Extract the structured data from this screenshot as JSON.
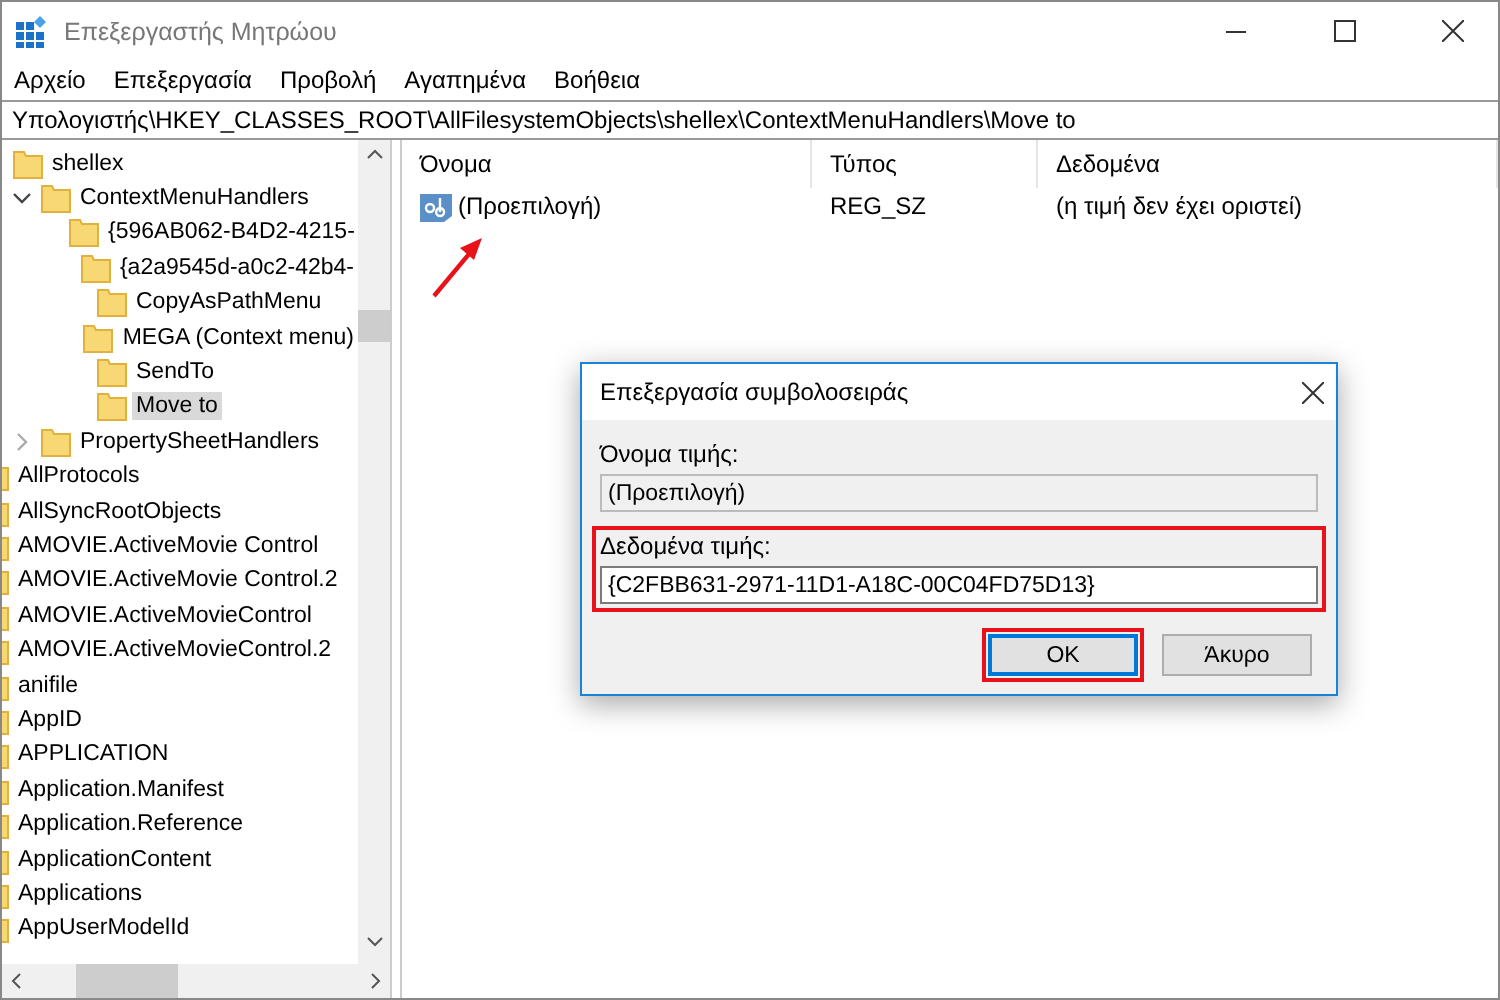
{
  "window": {
    "title": "Επεξεργαστής Μητρώου"
  },
  "menu": [
    "Αρχείο",
    "Επεξεργασία",
    "Προβολή",
    "Αγαπημένα",
    "Βοήθεια"
  ],
  "address": "Υπολογιστής\\HKEY_CLASSES_ROOT\\AllFilesystemObjects\\shellex\\ContextMenuHandlers\\Move to",
  "tree": {
    "branch": [
      {
        "label": "shellex",
        "selected": false,
        "children": [
          {
            "label": "ContextMenuHandlers",
            "expanded": true,
            "selected": false,
            "children": [
              {
                "label": "{596AB062-B4D2-4215-",
                "selected": false
              },
              {
                "label": "{a2a9545d-a0c2-42b4-",
                "selected": false
              },
              {
                "label": "CopyAsPathMenu",
                "selected": false
              },
              {
                "label": "MEGA (Context menu)",
                "selected": false
              },
              {
                "label": "SendTo",
                "selected": false
              },
              {
                "label": "Move to",
                "selected": true
              }
            ]
          },
          {
            "label": "PropertySheetHandlers",
            "expanded": false,
            "selected": false
          }
        ]
      }
    ],
    "root_items": [
      {
        "label": "AllProtocols",
        "selected": false
      },
      {
        "label": "AllSyncRootObjects",
        "selected": false
      },
      {
        "label": "AMOVIE.ActiveMovie Control",
        "selected": false
      },
      {
        "label": "AMOVIE.ActiveMovie Control.2",
        "selected": false
      },
      {
        "label": "AMOVIE.ActiveMovieControl",
        "selected": false
      },
      {
        "label": "AMOVIE.ActiveMovieControl.2",
        "selected": false
      },
      {
        "label": "anifile",
        "selected": false
      },
      {
        "label": "AppID",
        "selected": false
      },
      {
        "label": "APPLICATION",
        "selected": false
      },
      {
        "label": "Application.Manifest",
        "selected": false
      },
      {
        "label": "Application.Reference",
        "selected": false
      },
      {
        "label": "ApplicationContent",
        "selected": false
      },
      {
        "label": "Applications",
        "selected": false
      },
      {
        "label": "AppUserModelId",
        "selected": false
      }
    ]
  },
  "table": {
    "columns": [
      "Όνομα",
      "Τύπος",
      "Δεδομένα"
    ],
    "rows": [
      {
        "name": "(Προεπιλογή)",
        "type": "REG_SZ",
        "data": "(η τιμή δεν έχει οριστεί)"
      }
    ]
  },
  "dialog": {
    "title": "Επεξεργασία συμβολοσειράς",
    "name_label": "Όνομα τιμής:",
    "name_value": "(Προεπιλογή)",
    "data_label": "Δεδομένα τιμής:",
    "data_value": "{C2FBB631-2971-11D1-A18C-00C04FD75D13}",
    "buttons": [
      "OK",
      "Άκυρο"
    ]
  }
}
